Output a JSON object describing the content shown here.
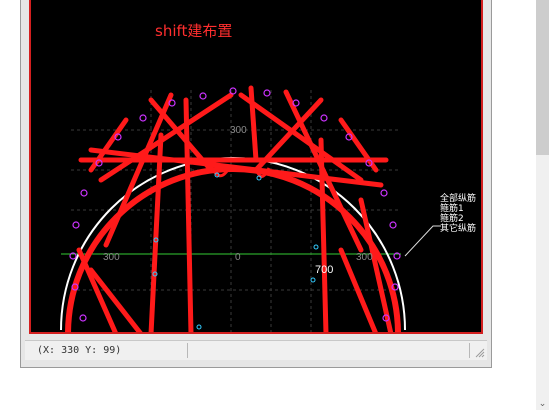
{
  "canvas": {
    "hint_text": "shift建布置",
    "legend": [
      "全部纵筋",
      "箍筋1",
      "箍筋2",
      "其它纵筋"
    ],
    "axis_labels": {
      "top": "300",
      "left": "300",
      "center": "0",
      "right": "300",
      "dimension": "700"
    },
    "colors": {
      "background": "#000000",
      "rebar": "#ff1a1a",
      "section_outline": "#ffffff",
      "axis_line": "#33cc33",
      "bar_marker": "#cc33ff",
      "point_marker": "#33ccff"
    }
  },
  "statusbar": {
    "coordinates": "(X: 330 Y: 99)"
  },
  "scrollbar": {
    "down_arrow": "⌄"
  }
}
